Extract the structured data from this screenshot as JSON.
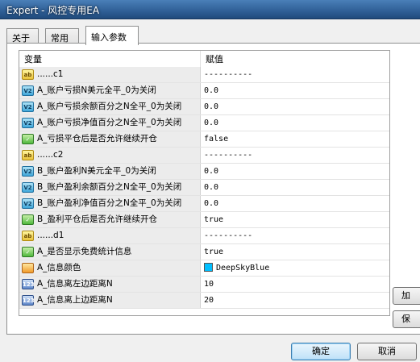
{
  "window": {
    "title": "Expert - 风控专用EA"
  },
  "tabs": [
    {
      "label": "关于",
      "active": false
    },
    {
      "label": "常用",
      "active": false
    },
    {
      "label": "输入参数",
      "active": true
    }
  ],
  "grid": {
    "headers": {
      "variable": "变量",
      "value": "赋值"
    },
    "rows": [
      {
        "icon": "ab",
        "name": "......c1",
        "value": "----------"
      },
      {
        "icon": "V2",
        "name": "A_账户亏损N美元全平_0为关闭",
        "value": "0.0"
      },
      {
        "icon": "V2",
        "name": "A_账户亏损余额百分之N全平_0为关闭",
        "value": "0.0"
      },
      {
        "icon": "V2",
        "name": "A_账户亏损净值百分之N全平_0为关闭",
        "value": "0.0"
      },
      {
        "icon": "bool",
        "name": "A_亏损平仓后是否允许继续开仓",
        "value": "false"
      },
      {
        "icon": "ab",
        "name": "......c2",
        "value": "----------"
      },
      {
        "icon": "V2",
        "name": "B_账户盈利N美元全平_0为关闭",
        "value": "0.0"
      },
      {
        "icon": "V2",
        "name": "B_账户盈利余额百分之N全平_0为关闭",
        "value": "0.0"
      },
      {
        "icon": "V2",
        "name": "B_账户盈利净值百分之N全平_0为关闭",
        "value": "0.0"
      },
      {
        "icon": "bool",
        "name": "B_盈利平仓后是否允许继续开仓",
        "value": "true"
      },
      {
        "icon": "ab",
        "name": "......d1",
        "value": "----------"
      },
      {
        "icon": "bool",
        "name": "A_是否显示免费统计信息",
        "value": "true"
      },
      {
        "icon": "color",
        "name": "A_信息颜色",
        "value": "DeepSkyBlue",
        "swatch": "#00bfff"
      },
      {
        "icon": "123",
        "name": "A_信息离左边距离N",
        "value": "10"
      },
      {
        "icon": "123",
        "name": "A_信息离上边距离N",
        "value": "20"
      }
    ]
  },
  "side_buttons": [
    {
      "label": "加"
    },
    {
      "label": "保"
    }
  ],
  "buttons": {
    "ok": "确定",
    "cancel": "取消"
  },
  "colors": {
    "title_bar": "#2f5f96",
    "swatch_deepskyblue": "#00bfff"
  }
}
